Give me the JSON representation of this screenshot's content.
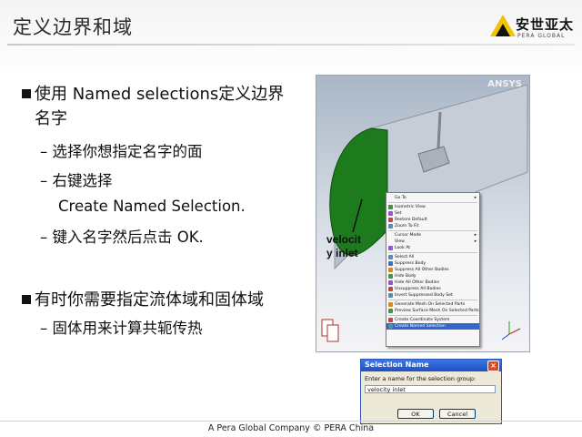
{
  "slide": {
    "title": "定义边界和域",
    "logo": {
      "text": "安世亚太",
      "sub": "PERA GLOBAL"
    },
    "bullets": [
      {
        "lines": [
          "使用 Named selections定义边界",
          "名字"
        ],
        "subs": [
          [
            "选择你想指定名字的面"
          ],
          [
            "右键选择",
            "Create Named Selection."
          ],
          [
            "键入名字然后点击 OK."
          ]
        ]
      },
      {
        "lines": [
          "有时你需要指定流体域和固体域"
        ],
        "subs": [
          [
            "固体用来计算共轭传热"
          ]
        ]
      }
    ],
    "dash": "–",
    "footer": "A Pera Global Company ©  PERA China"
  },
  "cad": {
    "brand": "ANSYS",
    "label_line1": "velocit",
    "label_line2": "y inlet",
    "face_color": "#1d7a1d",
    "body_color": "#c2c9d3"
  },
  "context_menu": {
    "items": [
      {
        "label": "Go To",
        "submenu": true,
        "icon": "none-icon"
      },
      {
        "sep": true
      },
      {
        "label": "Isometric View",
        "icon": "isometric-view-icon"
      },
      {
        "label": "Set",
        "icon": "set-icon"
      },
      {
        "label": "Restore Default",
        "icon": "restore-default-icon"
      },
      {
        "label": "Zoom To Fit",
        "icon": "zoom-to-fit-icon"
      },
      {
        "sep": true
      },
      {
        "label": "Cursor Mode",
        "submenu": true,
        "icon": "none-icon"
      },
      {
        "label": "View",
        "submenu": true,
        "icon": "none-icon"
      },
      {
        "label": "Look At",
        "icon": "look-at-icon"
      },
      {
        "sep": true
      },
      {
        "label": "Select All",
        "icon": "select-all-icon"
      },
      {
        "label": "Suppress Body",
        "icon": "suppress-body-icon"
      },
      {
        "label": "Suppress All Other Bodies",
        "icon": "suppress-others-icon"
      },
      {
        "label": "Hide Body",
        "icon": "hide-body-icon"
      },
      {
        "label": "Hide All Other Bodies",
        "icon": "hide-others-icon"
      },
      {
        "label": "Unsuppress All Bodies",
        "icon": "unsuppress-all-icon"
      },
      {
        "label": "Invert Suppressed Body Set",
        "icon": "invert-suppressed-icon"
      },
      {
        "sep": true
      },
      {
        "label": "Generate Mesh On Selected Parts",
        "icon": "generate-mesh-icon"
      },
      {
        "label": "Preview Surface Mesh On Selected Parts",
        "icon": "preview-mesh-icon"
      },
      {
        "sep": true
      },
      {
        "label": "Create Coordinate System",
        "icon": "coordinate-system-icon"
      },
      {
        "label": "Create Named Selection",
        "icon": "named-selection-icon",
        "selected": true
      }
    ]
  },
  "dialog": {
    "title": "Selection Name",
    "prompt": "Enter a name for the selection group:",
    "value": "velocity inlet",
    "ok_label": "OK",
    "cancel_label": "Cancel"
  }
}
